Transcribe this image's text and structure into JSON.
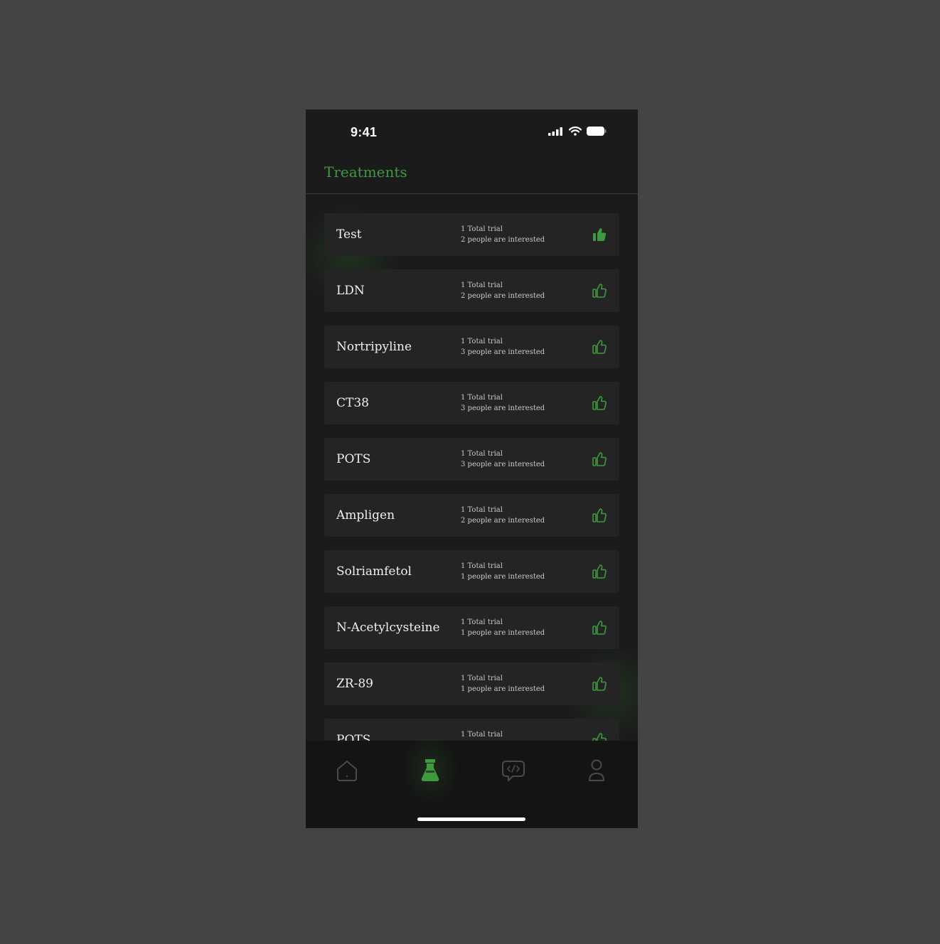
{
  "status_bar": {
    "time": "9:41"
  },
  "header": {
    "title": "Treatments"
  },
  "treatments": [
    {
      "name": "Test",
      "trials": "1 Total trial",
      "interested": "2 people are interested",
      "liked": true
    },
    {
      "name": "LDN",
      "trials": "1 Total trial",
      "interested": "2 people are interested",
      "liked": false
    },
    {
      "name": "Nortripyline",
      "trials": "1 Total trial",
      "interested": "3 people are interested",
      "liked": false
    },
    {
      "name": "CT38",
      "trials": "1 Total trial",
      "interested": "3 people are interested",
      "liked": false
    },
    {
      "name": "POTS",
      "trials": "1 Total trial",
      "interested": "3 people are interested",
      "liked": false
    },
    {
      "name": "Ampligen",
      "trials": "1 Total trial",
      "interested": "2 people are interested",
      "liked": false
    },
    {
      "name": "Solriamfetol",
      "trials": "1 Total trial",
      "interested": "1 people are interested",
      "liked": false
    },
    {
      "name": "N-Acetylcysteine",
      "trials": "1 Total trial",
      "interested": "1 people are interested",
      "liked": false
    },
    {
      "name": "ZR-89",
      "trials": "1 Total trial",
      "interested": "1 people are interested",
      "liked": false
    },
    {
      "name": "POTS",
      "trials": "1 Total trial",
      "interested": "",
      "liked": false
    }
  ],
  "tabs": [
    {
      "id": "home",
      "icon": "home-icon",
      "active": false
    },
    {
      "id": "treatments",
      "icon": "flask-icon",
      "active": true
    },
    {
      "id": "messages",
      "icon": "chat-code-icon",
      "active": false
    },
    {
      "id": "profile",
      "icon": "person-icon",
      "active": false
    }
  ],
  "colors": {
    "accent": "#3f9a3f",
    "background": "#1b1b1b",
    "card": "#242424",
    "page_background": "#444444"
  }
}
